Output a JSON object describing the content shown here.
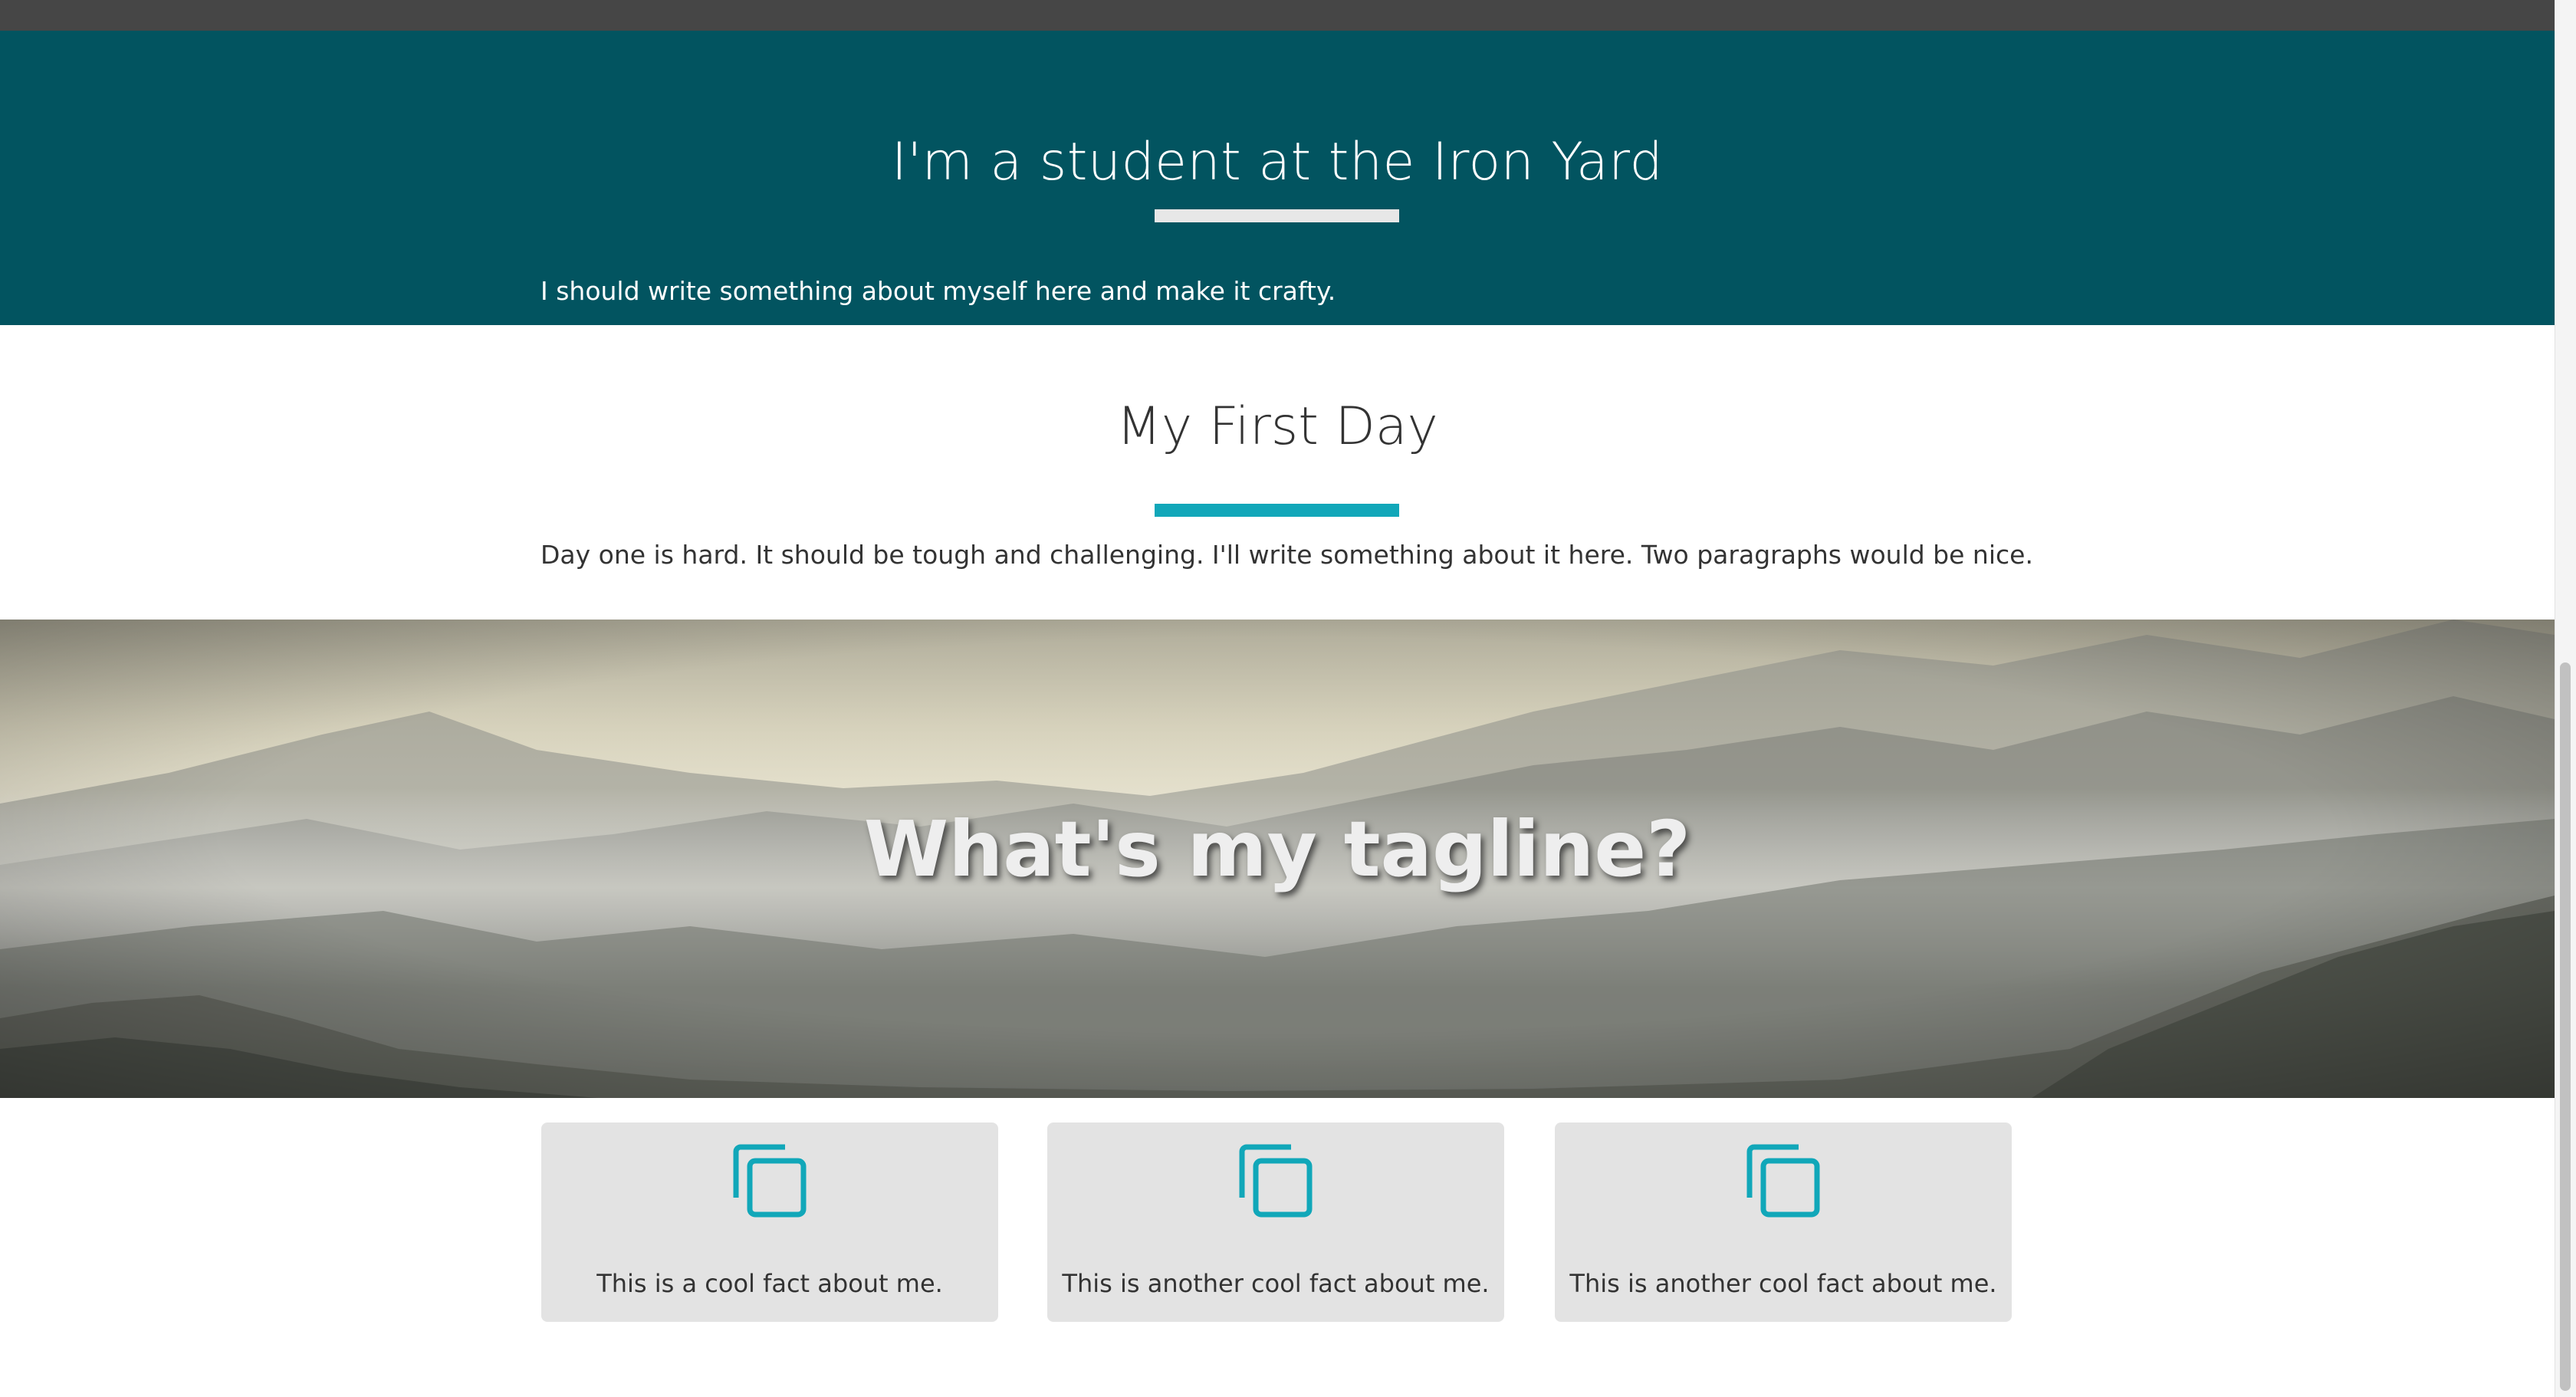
{
  "about": {
    "title": "I'm a student at the Iron Yard",
    "text": "I should write something about myself here and make it crafty."
  },
  "first_day": {
    "title": "My First Day",
    "text": "Day one is hard. It should be tough and challenging. I'll write something about it here. Two paragraphs would be nice."
  },
  "hero": {
    "tagline": "What's my tagline?"
  },
  "facts": [
    {
      "icon": "copy-icon",
      "text": "This is a cool fact about me."
    },
    {
      "icon": "copy-icon",
      "text": "This is another cool fact about me."
    },
    {
      "icon": "copy-icon",
      "text": "This is another cool fact about me."
    }
  ],
  "colors": {
    "header_bg": "#025460",
    "accent": "#11a7b9",
    "card_bg": "#e3e3e3",
    "top_strip": "#464646"
  }
}
